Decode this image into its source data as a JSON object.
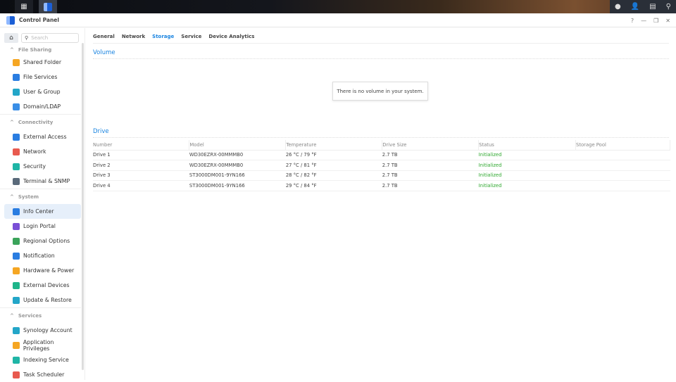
{
  "window": {
    "title": "Control Panel",
    "controls": [
      "?",
      "—",
      "❐",
      "✕"
    ]
  },
  "sidebar": {
    "search_placeholder": "Search",
    "groups": [
      {
        "label": "File Sharing",
        "items": [
          {
            "label": "Shared Folder",
            "color": "#f5a623"
          },
          {
            "label": "File Services",
            "color": "#2a7de1"
          },
          {
            "label": "User & Group",
            "color": "#23a6c8"
          },
          {
            "label": "Domain/LDAP",
            "color": "#3a8ee6"
          }
        ]
      },
      {
        "label": "Connectivity",
        "items": [
          {
            "label": "External Access",
            "color": "#2a7de1"
          },
          {
            "label": "Network",
            "color": "#e85a4f"
          },
          {
            "label": "Security",
            "color": "#1fb5a6"
          },
          {
            "label": "Terminal & SNMP",
            "color": "#5a6a7a"
          }
        ]
      },
      {
        "label": "System",
        "items": [
          {
            "label": "Info Center",
            "color": "#2a7de1",
            "active": true
          },
          {
            "label": "Login Portal",
            "color": "#7a4fd6"
          },
          {
            "label": "Regional Options",
            "color": "#3aa35a"
          },
          {
            "label": "Notification",
            "color": "#2a7de1"
          },
          {
            "label": "Hardware & Power",
            "color": "#f5a623"
          },
          {
            "label": "External Devices",
            "color": "#1fb58a"
          },
          {
            "label": "Update & Restore",
            "color": "#23a6c8"
          }
        ]
      },
      {
        "label": "Services",
        "items": [
          {
            "label": "Synology Account",
            "color": "#23a6c8"
          },
          {
            "label": "Application Privileges",
            "color": "#f5a623"
          },
          {
            "label": "Indexing Service",
            "color": "#1fb5a6"
          },
          {
            "label": "Task Scheduler",
            "color": "#e85a4f"
          }
        ]
      }
    ]
  },
  "tabs": [
    {
      "label": "General"
    },
    {
      "label": "Network"
    },
    {
      "label": "Storage",
      "active": true
    },
    {
      "label": "Service"
    },
    {
      "label": "Device Analytics"
    }
  ],
  "volume": {
    "title": "Volume",
    "empty_message": "There is no volume in your system."
  },
  "drive": {
    "title": "Drive",
    "columns": [
      "Number",
      "Model",
      "Temperature",
      "Drive Size",
      "Status",
      "Storage Pool"
    ],
    "rows": [
      [
        "Drive 1",
        "WD30EZRX-00MMMB0",
        "26 °C / 79 °F",
        "2.7 TB",
        "Initialized",
        ""
      ],
      [
        "Drive 2",
        "WD30EZRX-00MMMB0",
        "27 °C / 81 °F",
        "2.7 TB",
        "Initialized",
        ""
      ],
      [
        "Drive 3",
        "ST3000DM001-9YN166",
        "28 °C / 82 °F",
        "2.7 TB",
        "Initialized",
        ""
      ],
      [
        "Drive 4",
        "ST3000DM001-9YN166",
        "29 °C / 84 °F",
        "2.7 TB",
        "Initialized",
        ""
      ]
    ]
  },
  "colors": {
    "accent": "#1a84e0",
    "status_ok": "#2ea82e"
  }
}
